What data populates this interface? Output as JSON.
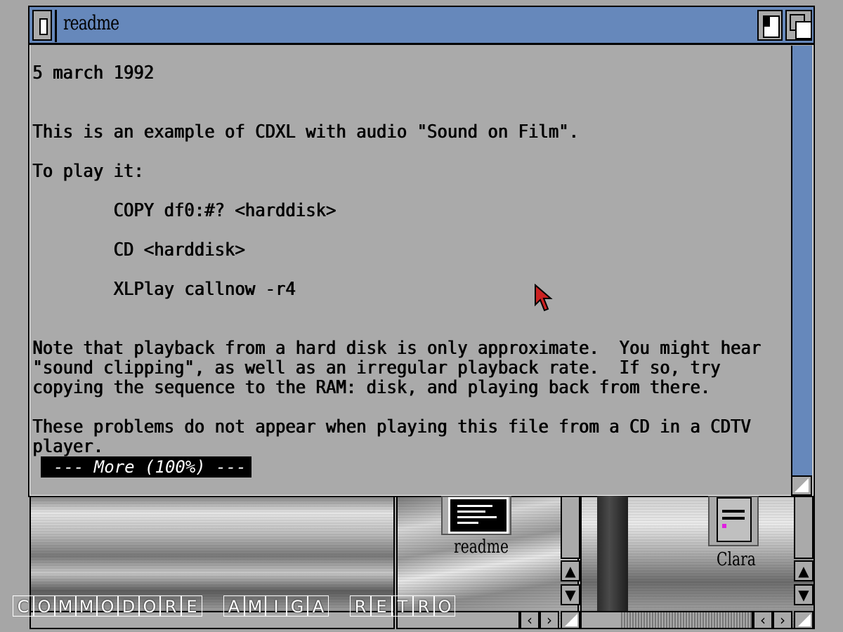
{
  "window": {
    "title": "readme",
    "more_prompt": "--- More (100%) ---"
  },
  "document": {
    "lines": [
      "5 march 1992",
      "This is an example of CDXL with audio \"Sound on Film\".",
      "To play it:",
      "        COPY df0:#? <harddisk>",
      "        CD <harddisk>",
      "        XLPlay callnow -r4",
      "Note that playback from a hard disk is only approximate.  You might hear",
      "\"sound clipping\", as well as an irregular playback rate.  If so, try",
      "copying the sequence to the RAM: disk, and playing back from there.",
      "These problems do not appear when playing this file from a CD in a CDTV",
      "player."
    ]
  },
  "desktop": {
    "icons": [
      {
        "label": "readme",
        "icon": "text-file-icon"
      },
      {
        "label": "Clara",
        "icon": "document-icon"
      }
    ]
  },
  "watermark": {
    "text": "COMMODORE AMIGA RETRO"
  },
  "colors": {
    "title_bar": "#6688bb",
    "window_bg": "#aaaaaa",
    "pointer": "#cc2222"
  }
}
